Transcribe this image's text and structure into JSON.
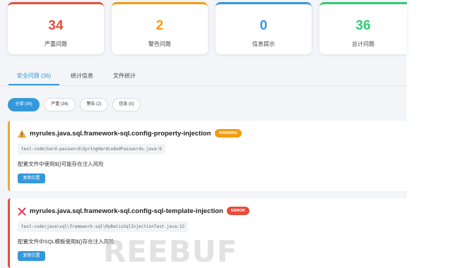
{
  "stats": [
    {
      "value": "34",
      "label": "严重问题",
      "color": "#e74c3c"
    },
    {
      "value": "2",
      "label": "警告问题",
      "color": "#f39c12"
    },
    {
      "value": "0",
      "label": "信息提示",
      "color": "#3498db"
    },
    {
      "value": "36",
      "label": "总计问题",
      "color": "#2ecc71"
    }
  ],
  "tabs": [
    {
      "label": "安全问题 (36)",
      "active": true
    },
    {
      "label": "统计信息",
      "active": false
    },
    {
      "label": "文件统计",
      "active": false
    }
  ],
  "filters": [
    {
      "label": "全部 (36)",
      "active": true
    },
    {
      "label": "严重 (34)",
      "active": false
    },
    {
      "label": "警告 (2)",
      "active": false
    },
    {
      "label": "信息 (0)",
      "active": false
    }
  ],
  "issues": [
    {
      "icon": "warning-icon",
      "title": "myrules.java.sql.framework-sql.config-property-injection",
      "severity": "WARNING",
      "path": "test-code\\hard-password\\SpringHardcodedPasswords.java:9",
      "message": "配置文件中使用${}可能存在注入风险",
      "copy_label": "复制位置"
    },
    {
      "icon": "error-x-icon",
      "title": "myrules.java.sql.framework-sql.config-sql-template-injection",
      "severity": "ERROR",
      "path": "test-code\\java\\sql\\framework-sql\\MyBatisSqlInjectionTest.java:13",
      "message": "配置文件中SQL模板使用${}存在注入风险",
      "copy_label": "复制位置"
    }
  ],
  "watermark": "REEBUF",
  "colors": {
    "accent": "#3498db",
    "error": "#e74c3c",
    "warning": "#f39c12",
    "success": "#2ecc71"
  }
}
